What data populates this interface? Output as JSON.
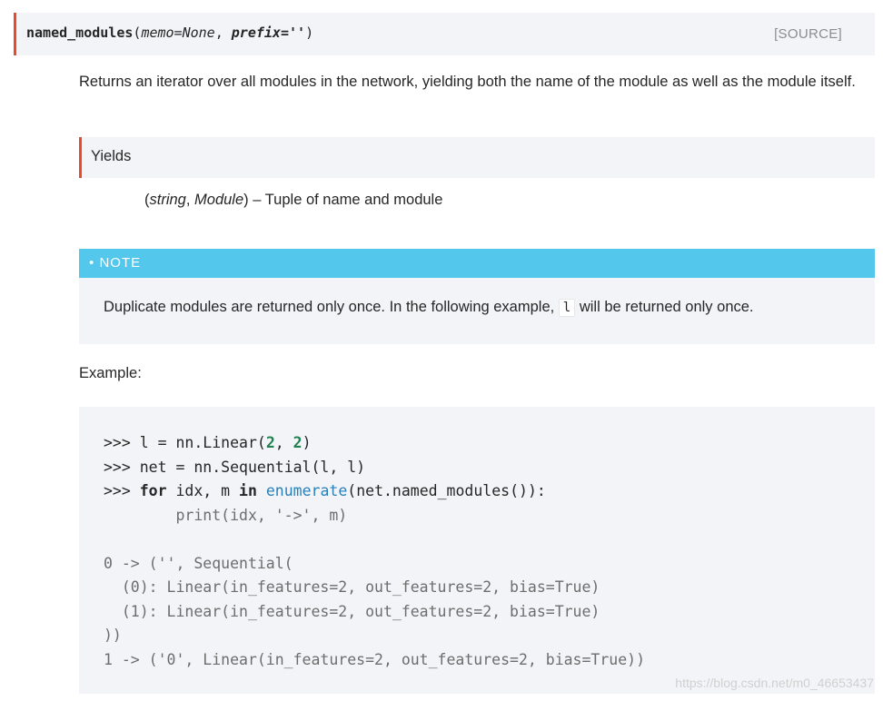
{
  "signature": {
    "name": "named_modules",
    "open_paren": "(",
    "memo": "memo=None",
    "comma": ", ",
    "prefix": "prefix=''",
    "close_paren": ")",
    "source_label": "[SOURCE]"
  },
  "description": "Returns an iterator over all modules in the network, yielding both the name of the module as well as the module itself.",
  "yields": {
    "label": "Yields",
    "type_open": "(",
    "type_string": "string",
    "type_comma": ", ",
    "type_module": "Module",
    "type_close": ")",
    "text": " – Tuple of name and module"
  },
  "note": {
    "bullet": "•",
    "title": "NOTE",
    "text_before": "Duplicate modules are returned only once. In the following example, ",
    "code": "l",
    "text_after": " will be returned only once."
  },
  "example_label": "Example:",
  "code": {
    "line1_prompt": ">>> ",
    "line1_a": "l = nn.Linear(",
    "line1_n1": "2",
    "line1_b": ", ",
    "line1_n2": "2",
    "line1_c": ")",
    "line2_prompt": ">>> ",
    "line2": "net = nn.Sequential(l, l)",
    "line3_prompt": ">>> ",
    "line3_for": "for",
    "line3_a": " idx, m ",
    "line3_in": "in",
    "line3_b": " ",
    "line3_enum": "enumerate",
    "line3_c": "(net.named_modules()):",
    "line4": "        print(idx, '->', m)",
    "out1": "0 -> ('', Sequential(",
    "out2": "  (0): Linear(in_features=2, out_features=2, bias=True)",
    "out3": "  (1): Linear(in_features=2, out_features=2, bias=True)",
    "out4": "))",
    "out5": "1 -> ('0', Linear(in_features=2, out_features=2, bias=True))"
  },
  "watermark": "https://blog.csdn.net/m0_46653437"
}
